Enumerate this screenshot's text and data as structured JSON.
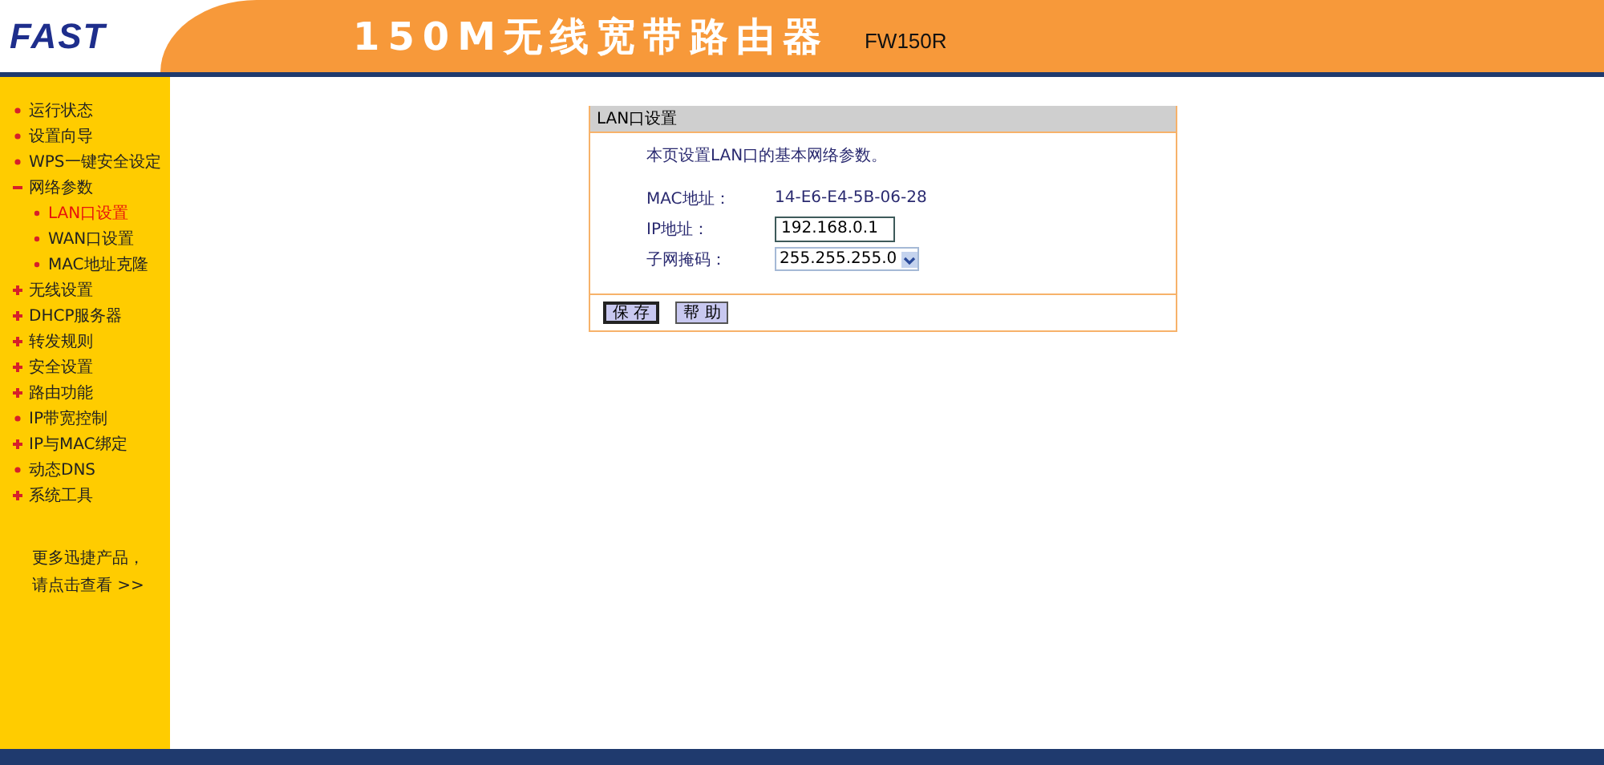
{
  "header": {
    "logo": "FAST",
    "title": "150M无线宽带路由器",
    "model": "FW150R"
  },
  "sidebar": {
    "items": [
      {
        "label": "运行状态",
        "kind": "page",
        "selected": false
      },
      {
        "label": "设置向导",
        "kind": "page",
        "selected": false
      },
      {
        "label": "WPS一键安全设定",
        "kind": "page",
        "selected": false
      },
      {
        "label": "网络参数",
        "kind": "menu",
        "expanded": true,
        "selected": false,
        "children": [
          {
            "label": "LAN口设置",
            "selected": true
          },
          {
            "label": "WAN口设置",
            "selected": false
          },
          {
            "label": "MAC地址克隆",
            "selected": false
          }
        ]
      },
      {
        "label": "无线设置",
        "kind": "menu",
        "expanded": false,
        "selected": false
      },
      {
        "label": "DHCP服务器",
        "kind": "menu",
        "expanded": false,
        "selected": false
      },
      {
        "label": "转发规则",
        "kind": "menu",
        "expanded": false,
        "selected": false
      },
      {
        "label": "安全设置",
        "kind": "menu",
        "expanded": false,
        "selected": false
      },
      {
        "label": "路由功能",
        "kind": "menu",
        "expanded": false,
        "selected": false
      },
      {
        "label": "IP带宽控制",
        "kind": "page",
        "selected": false
      },
      {
        "label": "IP与MAC绑定",
        "kind": "menu",
        "expanded": false,
        "selected": false
      },
      {
        "label": "动态DNS",
        "kind": "page",
        "selected": false
      },
      {
        "label": "系统工具",
        "kind": "menu",
        "expanded": false,
        "selected": false
      }
    ],
    "more": [
      "更多迅捷产品，",
      "请点击查看 >>"
    ]
  },
  "panel": {
    "title": "LAN口设置",
    "intro": "本页设置LAN口的基本网络参数。",
    "fields": [
      {
        "label": "MAC地址：",
        "kind": "text",
        "value": "14-E6-E4-5B-06-28"
      },
      {
        "label": "IP地址：",
        "kind": "input",
        "value": "192.168.0.1"
      },
      {
        "label": "子网掩码：",
        "kind": "select",
        "value": "255.255.255.0"
      }
    ],
    "buttons": [
      "保 存",
      "帮 助"
    ]
  }
}
